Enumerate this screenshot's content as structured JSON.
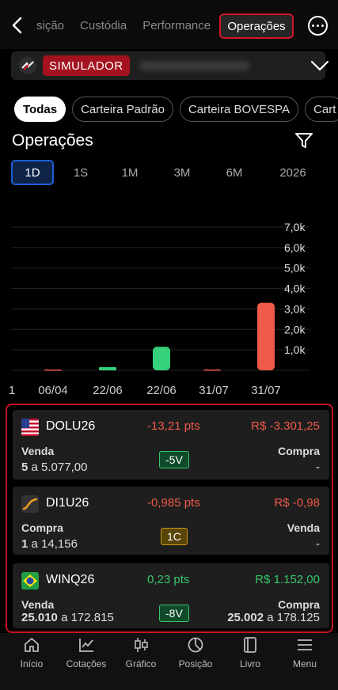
{
  "header": {
    "tabs": [
      "sição",
      "Custódia",
      "Performance"
    ],
    "active_tab": "Operações"
  },
  "account": {
    "badge": "SIMULADOR"
  },
  "chips": [
    "Todas",
    "Carteira Padrão",
    "Carteira BOVESPA",
    "Cart"
  ],
  "section": {
    "title": "Operações"
  },
  "periods": [
    "1D",
    "1S",
    "1M",
    "3M",
    "6M",
    "2026"
  ],
  "chart_data": {
    "type": "bar",
    "y_ticks": [
      "1,0k",
      "2,0k",
      "3,0k",
      "4,0k",
      "5,0k",
      "6,0k",
      "7,0k"
    ],
    "ylim": [
      0,
      7000
    ],
    "x_labels": [
      "1",
      "06/04",
      "22/06",
      "22/06",
      "31/07",
      "31/07"
    ],
    "categories": [
      "06/04",
      "22/06",
      "22/06",
      "31/07",
      "31/07"
    ],
    "values": [
      0,
      40,
      1150,
      0,
      3300
    ],
    "colors": [
      "#ef5a4a",
      "#35d07a",
      "#35d07a",
      "#ef5a4a",
      "#ef5a4a"
    ]
  },
  "operations": [
    {
      "symbol": "DOLU26",
      "flag": "us",
      "points": "-13,21 pts",
      "value": "R$ -3.301,25",
      "trend": "neg",
      "left_side": "Venda",
      "left_qty": "5",
      "left_at": "a",
      "left_price": "5.077,00",
      "right_side": "Compra",
      "right_qty": "",
      "right_at": "",
      "right_price": "-",
      "net": "-5V",
      "net_style": "green"
    },
    {
      "symbol": "DI1U26",
      "flag": "di",
      "points": "-0,985 pts",
      "value": "R$ -0,98",
      "trend": "neg",
      "left_side": "Compra",
      "left_qty": "1",
      "left_at": "a",
      "left_price": "14,156",
      "right_side": "Venda",
      "right_qty": "",
      "right_at": "",
      "right_price": "-",
      "net": "1C",
      "net_style": "gold"
    },
    {
      "symbol": "WINQ26",
      "flag": "br",
      "points": "0,23 pts",
      "value": "R$ 1.152,00",
      "trend": "pos",
      "left_side": "Venda",
      "left_qty": "25.010",
      "left_at": "a",
      "left_price": "172.815",
      "right_side": "Compra",
      "right_qty": "25.002",
      "right_at": "a",
      "right_price": "178.125",
      "net": "-8V",
      "net_style": "green"
    }
  ],
  "bottom_nav": [
    {
      "label": "Início",
      "icon": "home-icon"
    },
    {
      "label": "Cotações",
      "icon": "quotes-icon"
    },
    {
      "label": "Gráfico",
      "icon": "candlestick-icon"
    },
    {
      "label": "Posição",
      "icon": "pie-icon"
    },
    {
      "label": "Livro",
      "icon": "book-icon"
    },
    {
      "label": "Menu",
      "icon": "menu-icon"
    }
  ]
}
